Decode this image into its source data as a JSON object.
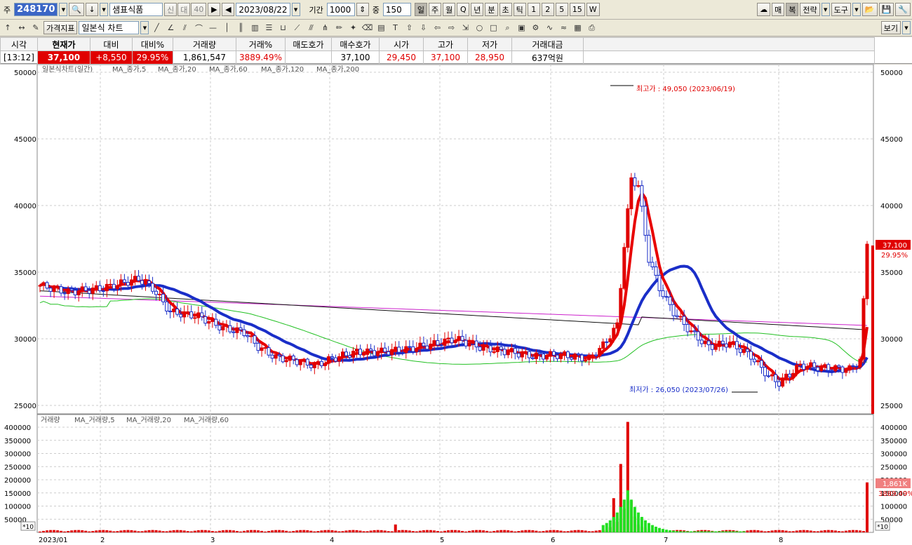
{
  "toolbar1": {
    "market_label": "주",
    "code": "248170",
    "name": "샘표식품",
    "badges": [
      "신",
      "대",
      "40"
    ],
    "date": "2023/08/22",
    "period_label": "기간",
    "period_value": "1000",
    "count_label": "중",
    "count_value": "150",
    "timeframes": [
      "일",
      "주",
      "월",
      "Q",
      "년",
      "분",
      "초",
      "틱",
      "1",
      "2",
      "5",
      "15",
      "W"
    ],
    "right_buttons": [
      "매",
      "복",
      "전략",
      "도구"
    ]
  },
  "toolbar2": {
    "indicator_btn": "가격지표",
    "chart_type": "일본식 차트",
    "view_btn": "보기"
  },
  "quote": {
    "headers": [
      "시각",
      "현재가",
      "대비",
      "대비%",
      "거래량",
      "거래%",
      "매도호가",
      "매수호가",
      "시가",
      "고가",
      "저가",
      "거래대금"
    ],
    "values": [
      "[13:12]",
      "37,100",
      "+8,550",
      "29.95%",
      "1,861,547",
      "3889.49%",
      "",
      "37,100",
      "29,450",
      "37,100",
      "28,950",
      "637억원"
    ]
  },
  "price_legend": "일본식차트(일간)",
  "price_ma": [
    "MA_종가,5",
    "MA_종가,20",
    "MA_종가,60",
    "MA_종가,120",
    "MA_종가,200"
  ],
  "vol_legend": "거래량",
  "vol_ma": [
    "MA_거래량,5",
    "MA_거래량,20",
    "MA_거래량,60"
  ],
  "annotations": {
    "high": "최고가 : 49,050 (2023/06/19)",
    "low": "최저가 : 26,050 (2023/07/26)",
    "cur_price": "37,100",
    "cur_pct": "29.95%",
    "cur_vol": "1,861K",
    "vol_pct": "3889.49%",
    "mult": "*10"
  },
  "colors": {
    "up": "#e00000",
    "down": "#1a2ec8",
    "ma5": "#e80000",
    "ma20": "#1a2ec8",
    "ma60": "#22c022",
    "ma120": "#111111",
    "ma200": "#cc22cc"
  },
  "chart_data": {
    "type": "candlestick",
    "price_ticks": [
      50000,
      45000,
      40000,
      35000,
      30000,
      25000
    ],
    "volume_ticks": [
      400000,
      350000,
      300000,
      250000,
      200000,
      150000,
      100000,
      50000
    ],
    "x_labels": [
      "2023/01",
      "2",
      "3",
      "4",
      "5",
      "6",
      "7",
      "8"
    ],
    "ylim": [
      24500,
      50000
    ],
    "high": {
      "value": 49050,
      "date": "2023/06/19"
    },
    "low": {
      "value": 26050,
      "date": "2023/07/26"
    },
    "last": {
      "close": 37100,
      "volume": 1861547
    }
  }
}
